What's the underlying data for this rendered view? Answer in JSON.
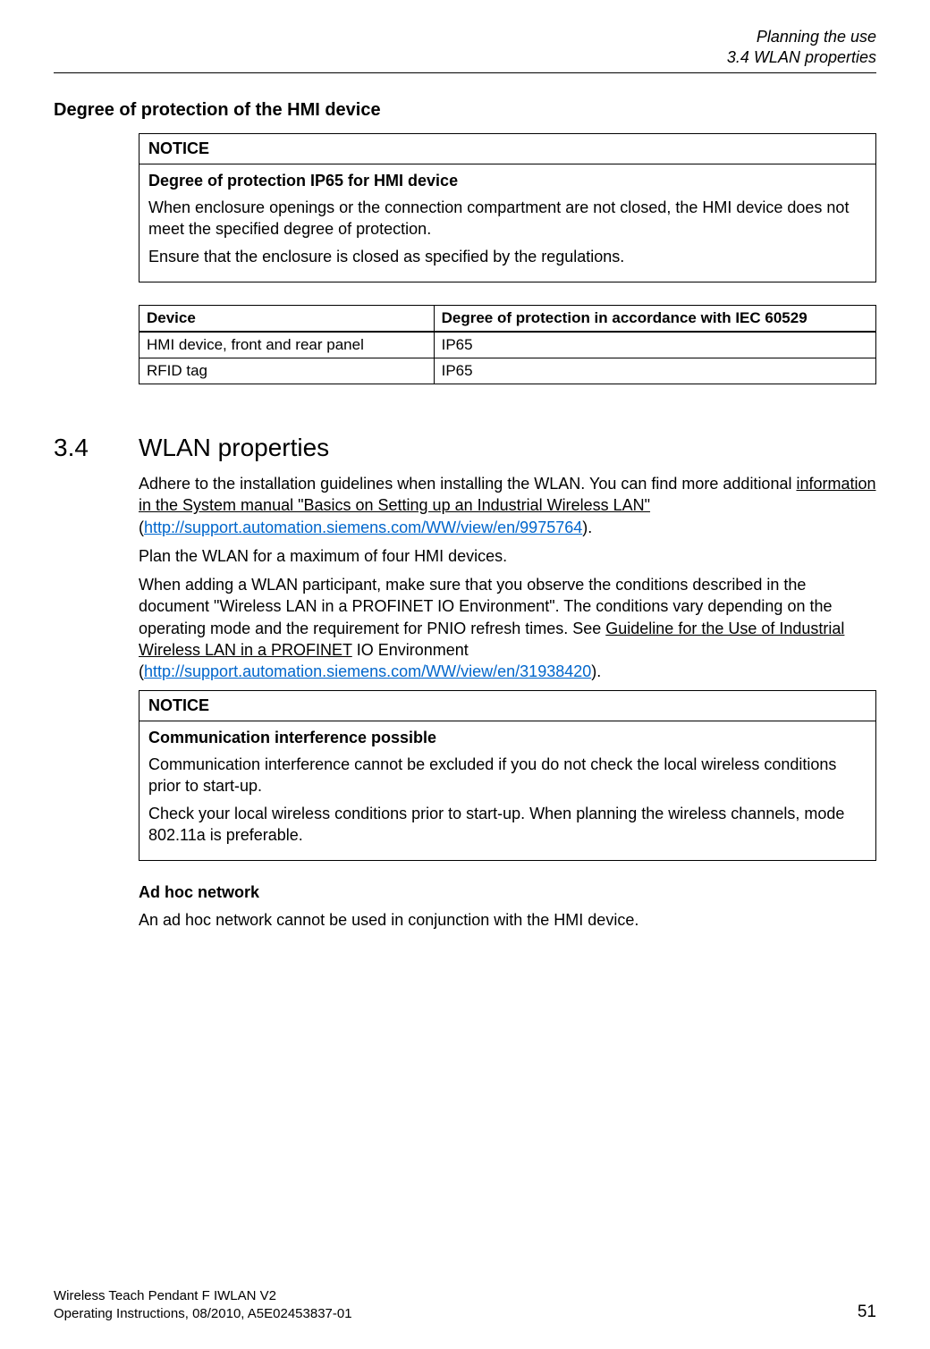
{
  "header": {
    "chapter": "Planning the use",
    "section": "3.4 WLAN properties"
  },
  "sec1": {
    "heading": "Degree of protection of the HMI device",
    "notice": {
      "label": "NOTICE",
      "title": "Degree of protection IP65 for HMI device",
      "p1": "When enclosure openings or the connection compartment are not closed, the HMI device does not meet the specified degree of protection.",
      "p2": "Ensure that the enclosure is closed as specified by the regulations."
    },
    "table": {
      "h1": "Device",
      "h2": "Degree of protection in accordance with IEC 60529",
      "r1c1": "HMI device, front and rear panel",
      "r1c2": "IP65",
      "r2c1": "RFID tag",
      "r2c2": "IP65"
    }
  },
  "sec2": {
    "num": "3.4",
    "title": "WLAN properties",
    "p1a": "Adhere to the installation guidelines when installing the WLAN. You can find more additional ",
    "p1b": "information in the System manual \"Basics on Setting up an Industrial Wireless LAN\"",
    "p1c": " (",
    "link1": "http://support.automation.siemens.com/WW/view/en/9975764",
    "p1d": ").",
    "p2": "Plan the WLAN for a maximum of four HMI devices.",
    "p3a": "When adding a WLAN participant, make sure that you observe the conditions described in the document \"Wireless LAN in a PROFINET IO Environment\". The conditions vary depending on the operating mode and the requirement for PNIO refresh times. See ",
    "p3b": "Guideline for the Use of Industrial Wireless LAN in a PROFINET",
    "p3c": " IO Environment (",
    "link2": "http://support.automation.siemens.com/WW/view/en/31938420",
    "p3d": ").",
    "notice": {
      "label": "NOTICE",
      "title": "Communication interference possible",
      "p1": "Communication interference cannot be excluded if you do not check the local wireless conditions prior to start-up.",
      "p2": "Check your local wireless conditions prior to start-up. When planning the wireless channels, mode 802.11a is preferable."
    },
    "sub": {
      "heading": "Ad hoc network",
      "p": "An ad hoc network cannot be used in conjunction with the HMI device."
    }
  },
  "footer": {
    "line1": "Wireless Teach Pendant F IWLAN V2",
    "line2": "Operating Instructions, 08/2010, A5E02453837-01",
    "page": "51"
  }
}
